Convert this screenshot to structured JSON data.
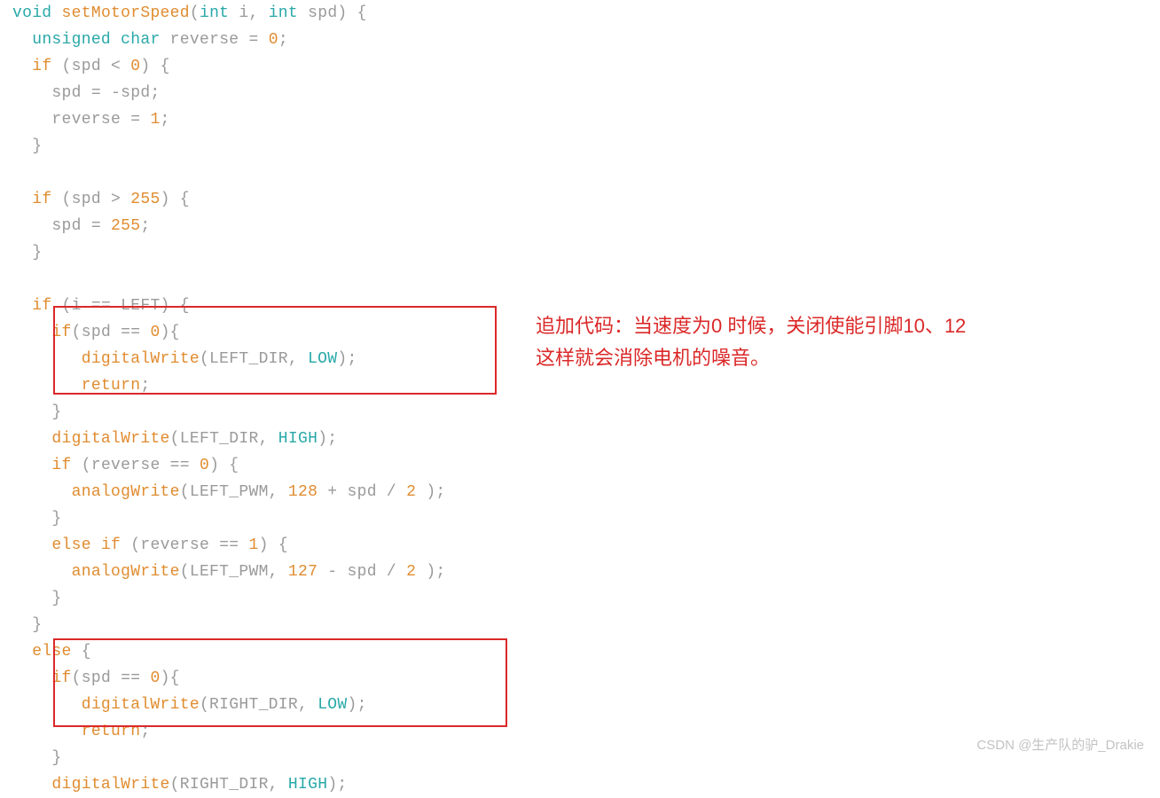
{
  "code": {
    "lines": [
      [
        [
          "kw",
          "void"
        ],
        [
          "id",
          " "
        ],
        [
          "fn",
          "setMotorSpeed"
        ],
        [
          "id",
          "("
        ],
        [
          "kw",
          "int"
        ],
        [
          "id",
          " i, "
        ],
        [
          "kw",
          "int"
        ],
        [
          "id",
          " spd) {"
        ]
      ],
      [
        [
          "id",
          "  "
        ],
        [
          "kw",
          "unsigned"
        ],
        [
          "id",
          " "
        ],
        [
          "kw",
          "char"
        ],
        [
          "id",
          " reverse = "
        ],
        [
          "num",
          "0"
        ],
        [
          "id",
          ";"
        ]
      ],
      [
        [
          "id",
          "  "
        ],
        [
          "ctrl",
          "if"
        ],
        [
          "id",
          " (spd < "
        ],
        [
          "num",
          "0"
        ],
        [
          "id",
          ") {"
        ]
      ],
      [
        [
          "id",
          "    spd = -spd;"
        ]
      ],
      [
        [
          "id",
          "    reverse = "
        ],
        [
          "num",
          "1"
        ],
        [
          "id",
          ";"
        ]
      ],
      [
        [
          "id",
          "  }"
        ]
      ],
      [
        [
          "id",
          ""
        ]
      ],
      [
        [
          "id",
          "  "
        ],
        [
          "ctrl",
          "if"
        ],
        [
          "id",
          " (spd > "
        ],
        [
          "num",
          "255"
        ],
        [
          "id",
          ") {"
        ]
      ],
      [
        [
          "id",
          "    spd = "
        ],
        [
          "num",
          "255"
        ],
        [
          "id",
          ";"
        ]
      ],
      [
        [
          "id",
          "  }"
        ]
      ],
      [
        [
          "id",
          ""
        ]
      ],
      [
        [
          "id",
          "  "
        ],
        [
          "ctrl",
          "if"
        ],
        [
          "id",
          " (i == LEFT) {"
        ]
      ],
      [
        [
          "id",
          "    "
        ],
        [
          "ctrl",
          "if"
        ],
        [
          "id",
          "(spd == "
        ],
        [
          "num",
          "0"
        ],
        [
          "id",
          "){"
        ]
      ],
      [
        [
          "id",
          "       "
        ],
        [
          "fn",
          "digitalWrite"
        ],
        [
          "id",
          "(LEFT_DIR, "
        ],
        [
          "const",
          "LOW"
        ],
        [
          "id",
          ");"
        ]
      ],
      [
        [
          "id",
          "       "
        ],
        [
          "ctrl",
          "return"
        ],
        [
          "id",
          ";"
        ]
      ],
      [
        [
          "id",
          "    }"
        ]
      ],
      [
        [
          "id",
          "    "
        ],
        [
          "fn",
          "digitalWrite"
        ],
        [
          "id",
          "(LEFT_DIR, "
        ],
        [
          "const",
          "HIGH"
        ],
        [
          "id",
          ");"
        ]
      ],
      [
        [
          "id",
          "    "
        ],
        [
          "ctrl",
          "if"
        ],
        [
          "id",
          " (reverse == "
        ],
        [
          "num",
          "0"
        ],
        [
          "id",
          ") {"
        ]
      ],
      [
        [
          "id",
          "      "
        ],
        [
          "fn",
          "analogWrite"
        ],
        [
          "id",
          "(LEFT_PWM, "
        ],
        [
          "num",
          "128"
        ],
        [
          "id",
          " + spd / "
        ],
        [
          "num",
          "2"
        ],
        [
          "id",
          " );"
        ]
      ],
      [
        [
          "id",
          "    }"
        ]
      ],
      [
        [
          "id",
          "    "
        ],
        [
          "ctrl",
          "else"
        ],
        [
          "id",
          " "
        ],
        [
          "ctrl",
          "if"
        ],
        [
          "id",
          " (reverse == "
        ],
        [
          "num",
          "1"
        ],
        [
          "id",
          ") {"
        ]
      ],
      [
        [
          "id",
          "      "
        ],
        [
          "fn",
          "analogWrite"
        ],
        [
          "id",
          "(LEFT_PWM, "
        ],
        [
          "num",
          "127"
        ],
        [
          "id",
          " - spd / "
        ],
        [
          "num",
          "2"
        ],
        [
          "id",
          " );"
        ]
      ],
      [
        [
          "id",
          "    }"
        ]
      ],
      [
        [
          "id",
          "  }"
        ]
      ],
      [
        [
          "id",
          "  "
        ],
        [
          "ctrl",
          "else"
        ],
        [
          "id",
          " {"
        ]
      ],
      [
        [
          "id",
          "    "
        ],
        [
          "ctrl",
          "if"
        ],
        [
          "id",
          "(spd == "
        ],
        [
          "num",
          "0"
        ],
        [
          "id",
          "){"
        ]
      ],
      [
        [
          "id",
          "       "
        ],
        [
          "fn",
          "digitalWrite"
        ],
        [
          "id",
          "(RIGHT_DIR, "
        ],
        [
          "const",
          "LOW"
        ],
        [
          "id",
          ");"
        ]
      ],
      [
        [
          "id",
          "       "
        ],
        [
          "ctrl",
          "return"
        ],
        [
          "id",
          ";"
        ]
      ],
      [
        [
          "id",
          "    }"
        ]
      ],
      [
        [
          "id",
          "    "
        ],
        [
          "fn",
          "digitalWrite"
        ],
        [
          "id",
          "(RIGHT_DIR, "
        ],
        [
          "const",
          "HIGH"
        ],
        [
          "id",
          ");"
        ]
      ]
    ]
  },
  "annotation": {
    "line1": "追加代码：当速度为0 时候，关闭使能引脚10、12",
    "line2": "这样就会消除电机的噪音。"
  },
  "watermark": "CSDN @生产队的驴_Drakie"
}
